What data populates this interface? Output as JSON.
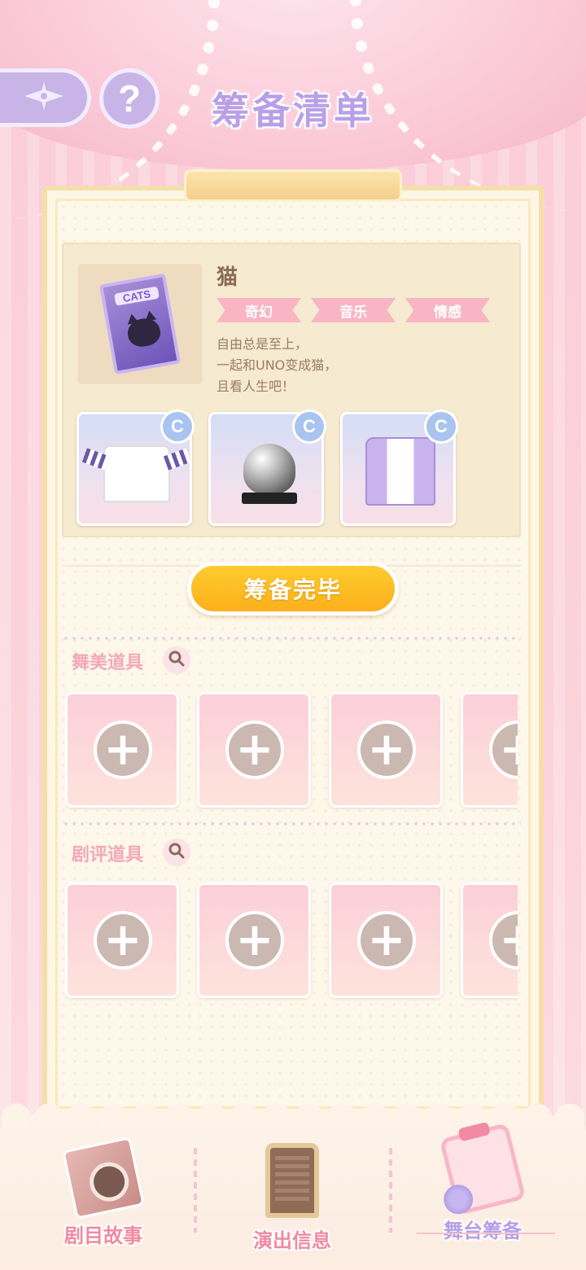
{
  "header": {
    "title": "筹备清单",
    "back_icon": "sparkle-back-icon",
    "help_symbol": "?"
  },
  "show": {
    "name": "猫",
    "cover_label": "CATS",
    "tags": [
      "奇幻",
      "音乐",
      "情感"
    ],
    "description": [
      "自由总是至上，",
      "一起和UNO变成猫，",
      "且看人生吧！"
    ],
    "outfits": [
      {
        "item": "cat-print-tee",
        "badge": "C"
      },
      {
        "item": "cat-ear-helmet",
        "badge": "C"
      },
      {
        "item": "purple-jacket-outfit",
        "badge": "C"
      }
    ]
  },
  "confirm_button": "筹备完毕",
  "sections": [
    {
      "label": "舞美道具",
      "slot_count": 4
    },
    {
      "label": "剧评道具",
      "slot_count": 4
    }
  ],
  "plus_symbol": "+",
  "bottom_nav": [
    {
      "label": "剧目故事",
      "icon": "storybook-icon",
      "active": false
    },
    {
      "label": "演出信息",
      "icon": "info-board-icon",
      "active": false
    },
    {
      "label": "舞台筹备",
      "icon": "clipboard-icon",
      "active": true
    }
  ],
  "colors": {
    "accent_purple": "#b9a0e6",
    "tag_pink": "#f8b6c4",
    "button_yellow": "#fbb01b",
    "section_pink": "#f4a7b9"
  }
}
